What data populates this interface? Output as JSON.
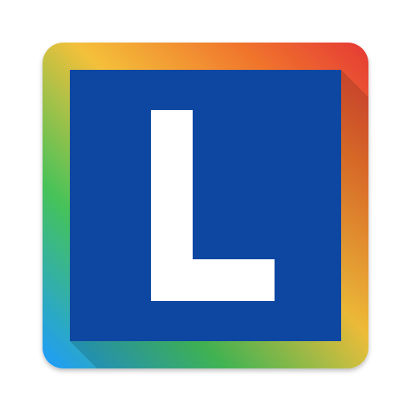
{
  "icon": {
    "name": "app-launcher-icon",
    "letter": "L",
    "colors": {
      "panel": "#0D47A1",
      "letter": "#FFFFFF",
      "frame_gradient": [
        "#1E9BFF",
        "#4CC24C",
        "#F4C03A",
        "#F0652E",
        "#E53935"
      ],
      "shadow": "#000000"
    }
  }
}
